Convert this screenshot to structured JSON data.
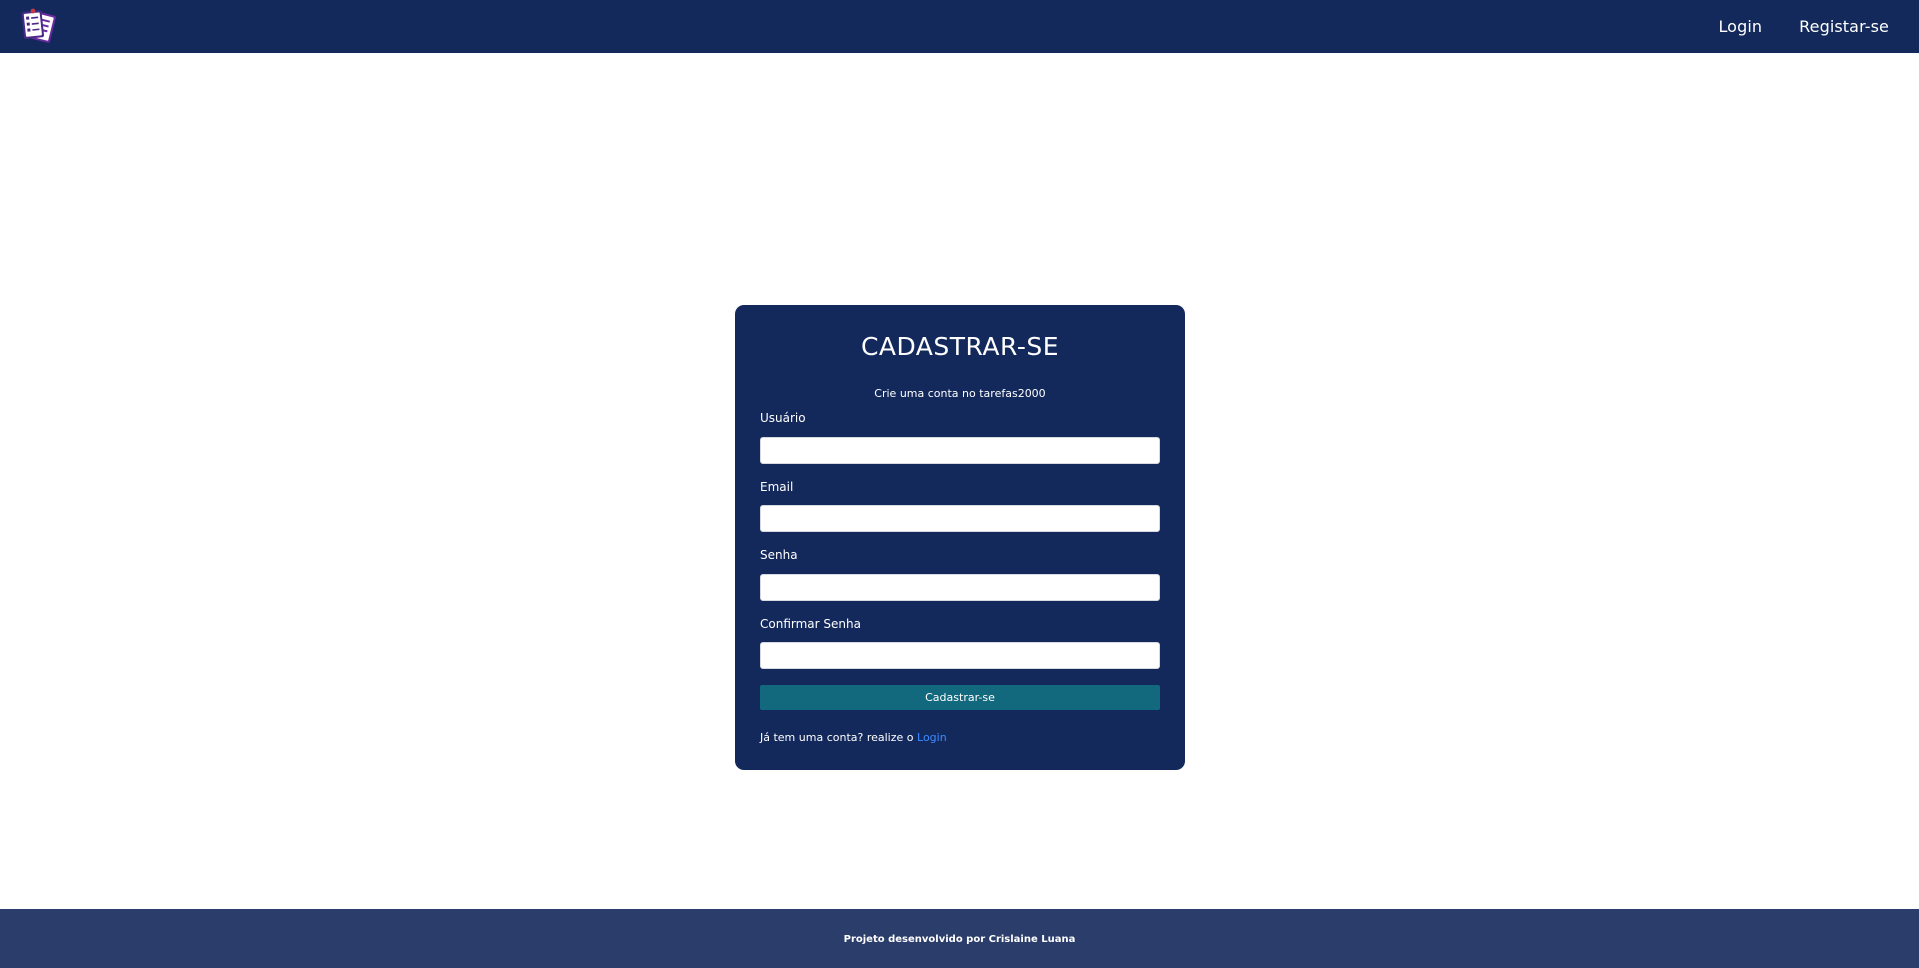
{
  "navbar": {
    "logo_icon": "task-list-icon",
    "links": {
      "login": "Login",
      "register": "Registar-se"
    }
  },
  "form": {
    "title": "CADASTRAR-SE",
    "subtitle": "Crie uma conta no tarefas2000",
    "fields": {
      "username": {
        "label": "Usuário",
        "value": "",
        "placeholder": ""
      },
      "email": {
        "label": "Email",
        "value": "",
        "placeholder": ""
      },
      "password": {
        "label": "Senha",
        "value": "",
        "placeholder": ""
      },
      "confirm_password": {
        "label": "Confirmar Senha",
        "value": "",
        "placeholder": ""
      }
    },
    "submit_label": "Cadastrar-se",
    "login_hint": "Já tem uma conta? realize o ",
    "login_link": "Login"
  },
  "footer": {
    "text": "Projeto desenvolvido por Crislaine Luana"
  },
  "colors": {
    "navbar_bg": "#13295c",
    "card_bg": "#13295c",
    "button_bg": "#12687c",
    "link": "#3b8bff",
    "footer_bg": "#2b3d6b"
  }
}
